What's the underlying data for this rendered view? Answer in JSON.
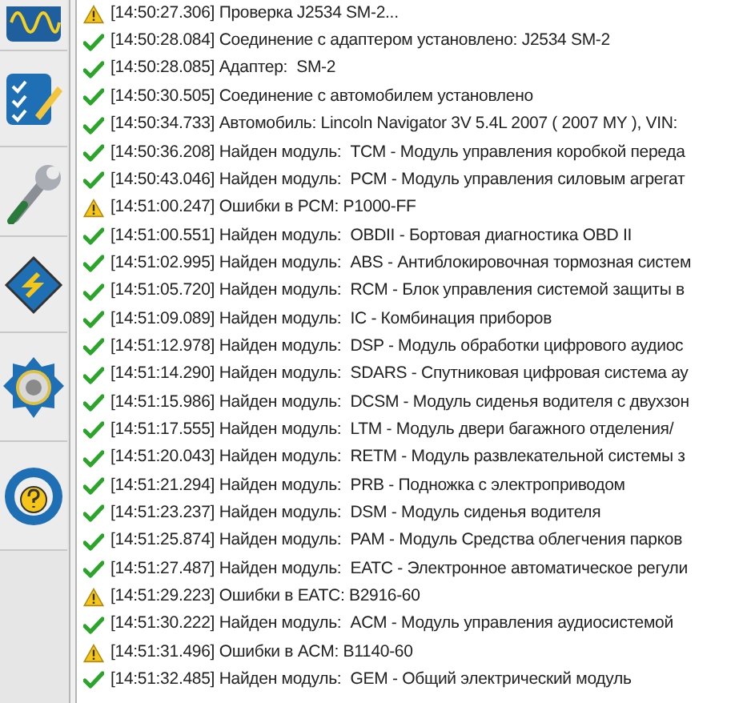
{
  "log": [
    {
      "kind": "warning",
      "time": "[14:50:27.306]",
      "text": "Проверка J2534 SM-2..."
    },
    {
      "kind": "ok",
      "time": "[14:50:28.084]",
      "text": "Соединение с адаптером установлено: J2534 SM-2"
    },
    {
      "kind": "ok",
      "time": "[14:50:28.085]",
      "text": "Адаптер:  SM-2"
    },
    {
      "kind": "ok",
      "time": "[14:50:30.505]",
      "text": "Соединение с автомобилем установлено"
    },
    {
      "kind": "ok",
      "time": "[14:50:34.733]",
      "text": "Автомобиль: Lincoln Navigator 3V 5.4L 2007 ( 2007 MY ), VIN:"
    },
    {
      "kind": "ok",
      "time": "[14:50:36.208]",
      "text": "Найден модуль:  TCM - Модуль управления коробкой переда"
    },
    {
      "kind": "ok",
      "time": "[14:50:43.046]",
      "text": "Найден модуль:  PCM - Модуль управления силовым агрегат"
    },
    {
      "kind": "warning",
      "time": "[14:51:00.247]",
      "text": "Ошибки в PCM: P1000-FF"
    },
    {
      "kind": "ok",
      "time": "[14:51:00.551]",
      "text": "Найден модуль:  OBDII - Бортовая диагностика OBD II"
    },
    {
      "kind": "ok",
      "time": "[14:51:02.995]",
      "text": "Найден модуль:  ABS - Антиблокировочная тормозная систем"
    },
    {
      "kind": "ok",
      "time": "[14:51:05.720]",
      "text": "Найден модуль:  RCM - Блок управления системой защиты в"
    },
    {
      "kind": "ok",
      "time": "[14:51:09.089]",
      "text": "Найден модуль:  IC - Комбинация приборов"
    },
    {
      "kind": "ok",
      "time": "[14:51:12.978]",
      "text": "Найден модуль:  DSP - Модуль обработки цифрового аудиос"
    },
    {
      "kind": "ok",
      "time": "[14:51:14.290]",
      "text": "Найден модуль:  SDARS - Спутниковая цифровая система ау"
    },
    {
      "kind": "ok",
      "time": "[14:51:15.986]",
      "text": "Найден модуль:  DCSM - Модуль сиденья водителя с двухзон"
    },
    {
      "kind": "ok",
      "time": "[14:51:17.555]",
      "text": "Найден модуль:  LTM - Модуль двери багажного отделения/"
    },
    {
      "kind": "ok",
      "time": "[14:51:20.043]",
      "text": "Найден модуль:  RETM - Модуль развлекательной системы з"
    },
    {
      "kind": "ok",
      "time": "[14:51:21.294]",
      "text": "Найден модуль:  PRB - Подножка с электроприводом"
    },
    {
      "kind": "ok",
      "time": "[14:51:23.237]",
      "text": "Найден модуль:  DSM - Модуль сиденья водителя"
    },
    {
      "kind": "ok",
      "time": "[14:51:25.874]",
      "text": "Найден модуль:  PAM - Модуль Средства облегчения парков"
    },
    {
      "kind": "ok",
      "time": "[14:51:27.487]",
      "text": "Найден модуль:  EATC - Электронное автоматическое регули"
    },
    {
      "kind": "warning",
      "time": "[14:51:29.223]",
      "text": "Ошибки в EATC: B2916-60"
    },
    {
      "kind": "ok",
      "time": "[14:51:30.222]",
      "text": "Найден модуль:  ACM - Модуль управления аудиосистемой"
    },
    {
      "kind": "warning",
      "time": "[14:51:31.496]",
      "text": "Ошибки в ACM: B1140-60"
    },
    {
      "kind": "ok",
      "time": "[14:51:32.485]",
      "text": "Найден модуль:  GEM - Общий электрический модуль"
    }
  ]
}
